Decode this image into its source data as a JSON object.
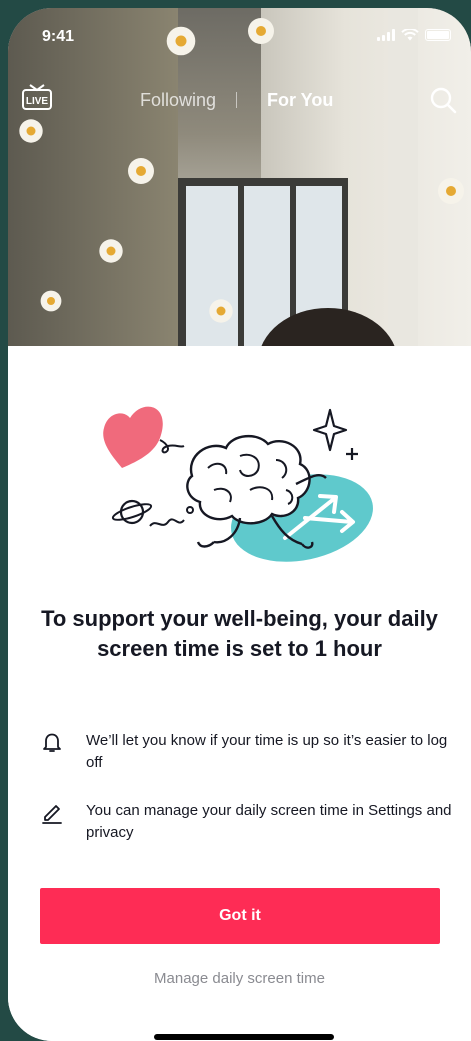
{
  "status_bar": {
    "time": "9:41"
  },
  "top_nav": {
    "live_label": "LIVE",
    "tabs": [
      {
        "label": "Following",
        "active": false
      },
      {
        "label": "For You",
        "active": true
      }
    ]
  },
  "sheet": {
    "headline": "To support your well-being, your daily screen time is set to 1 hour",
    "info_rows": [
      {
        "icon": "bell-icon",
        "text": "We’ll let you know if your time is up so it’s easier to log off"
      },
      {
        "icon": "pencil-icon",
        "text": "You can manage your daily screen time in Settings and privacy"
      }
    ],
    "primary_button": "Got it",
    "secondary_link": "Manage daily screen time"
  },
  "colors": {
    "accent": "#fe2c55",
    "heart": "#f06a7c",
    "teal_blob": "#5fc9cc",
    "text_primary": "#161823",
    "text_secondary": "#8a8b91"
  }
}
